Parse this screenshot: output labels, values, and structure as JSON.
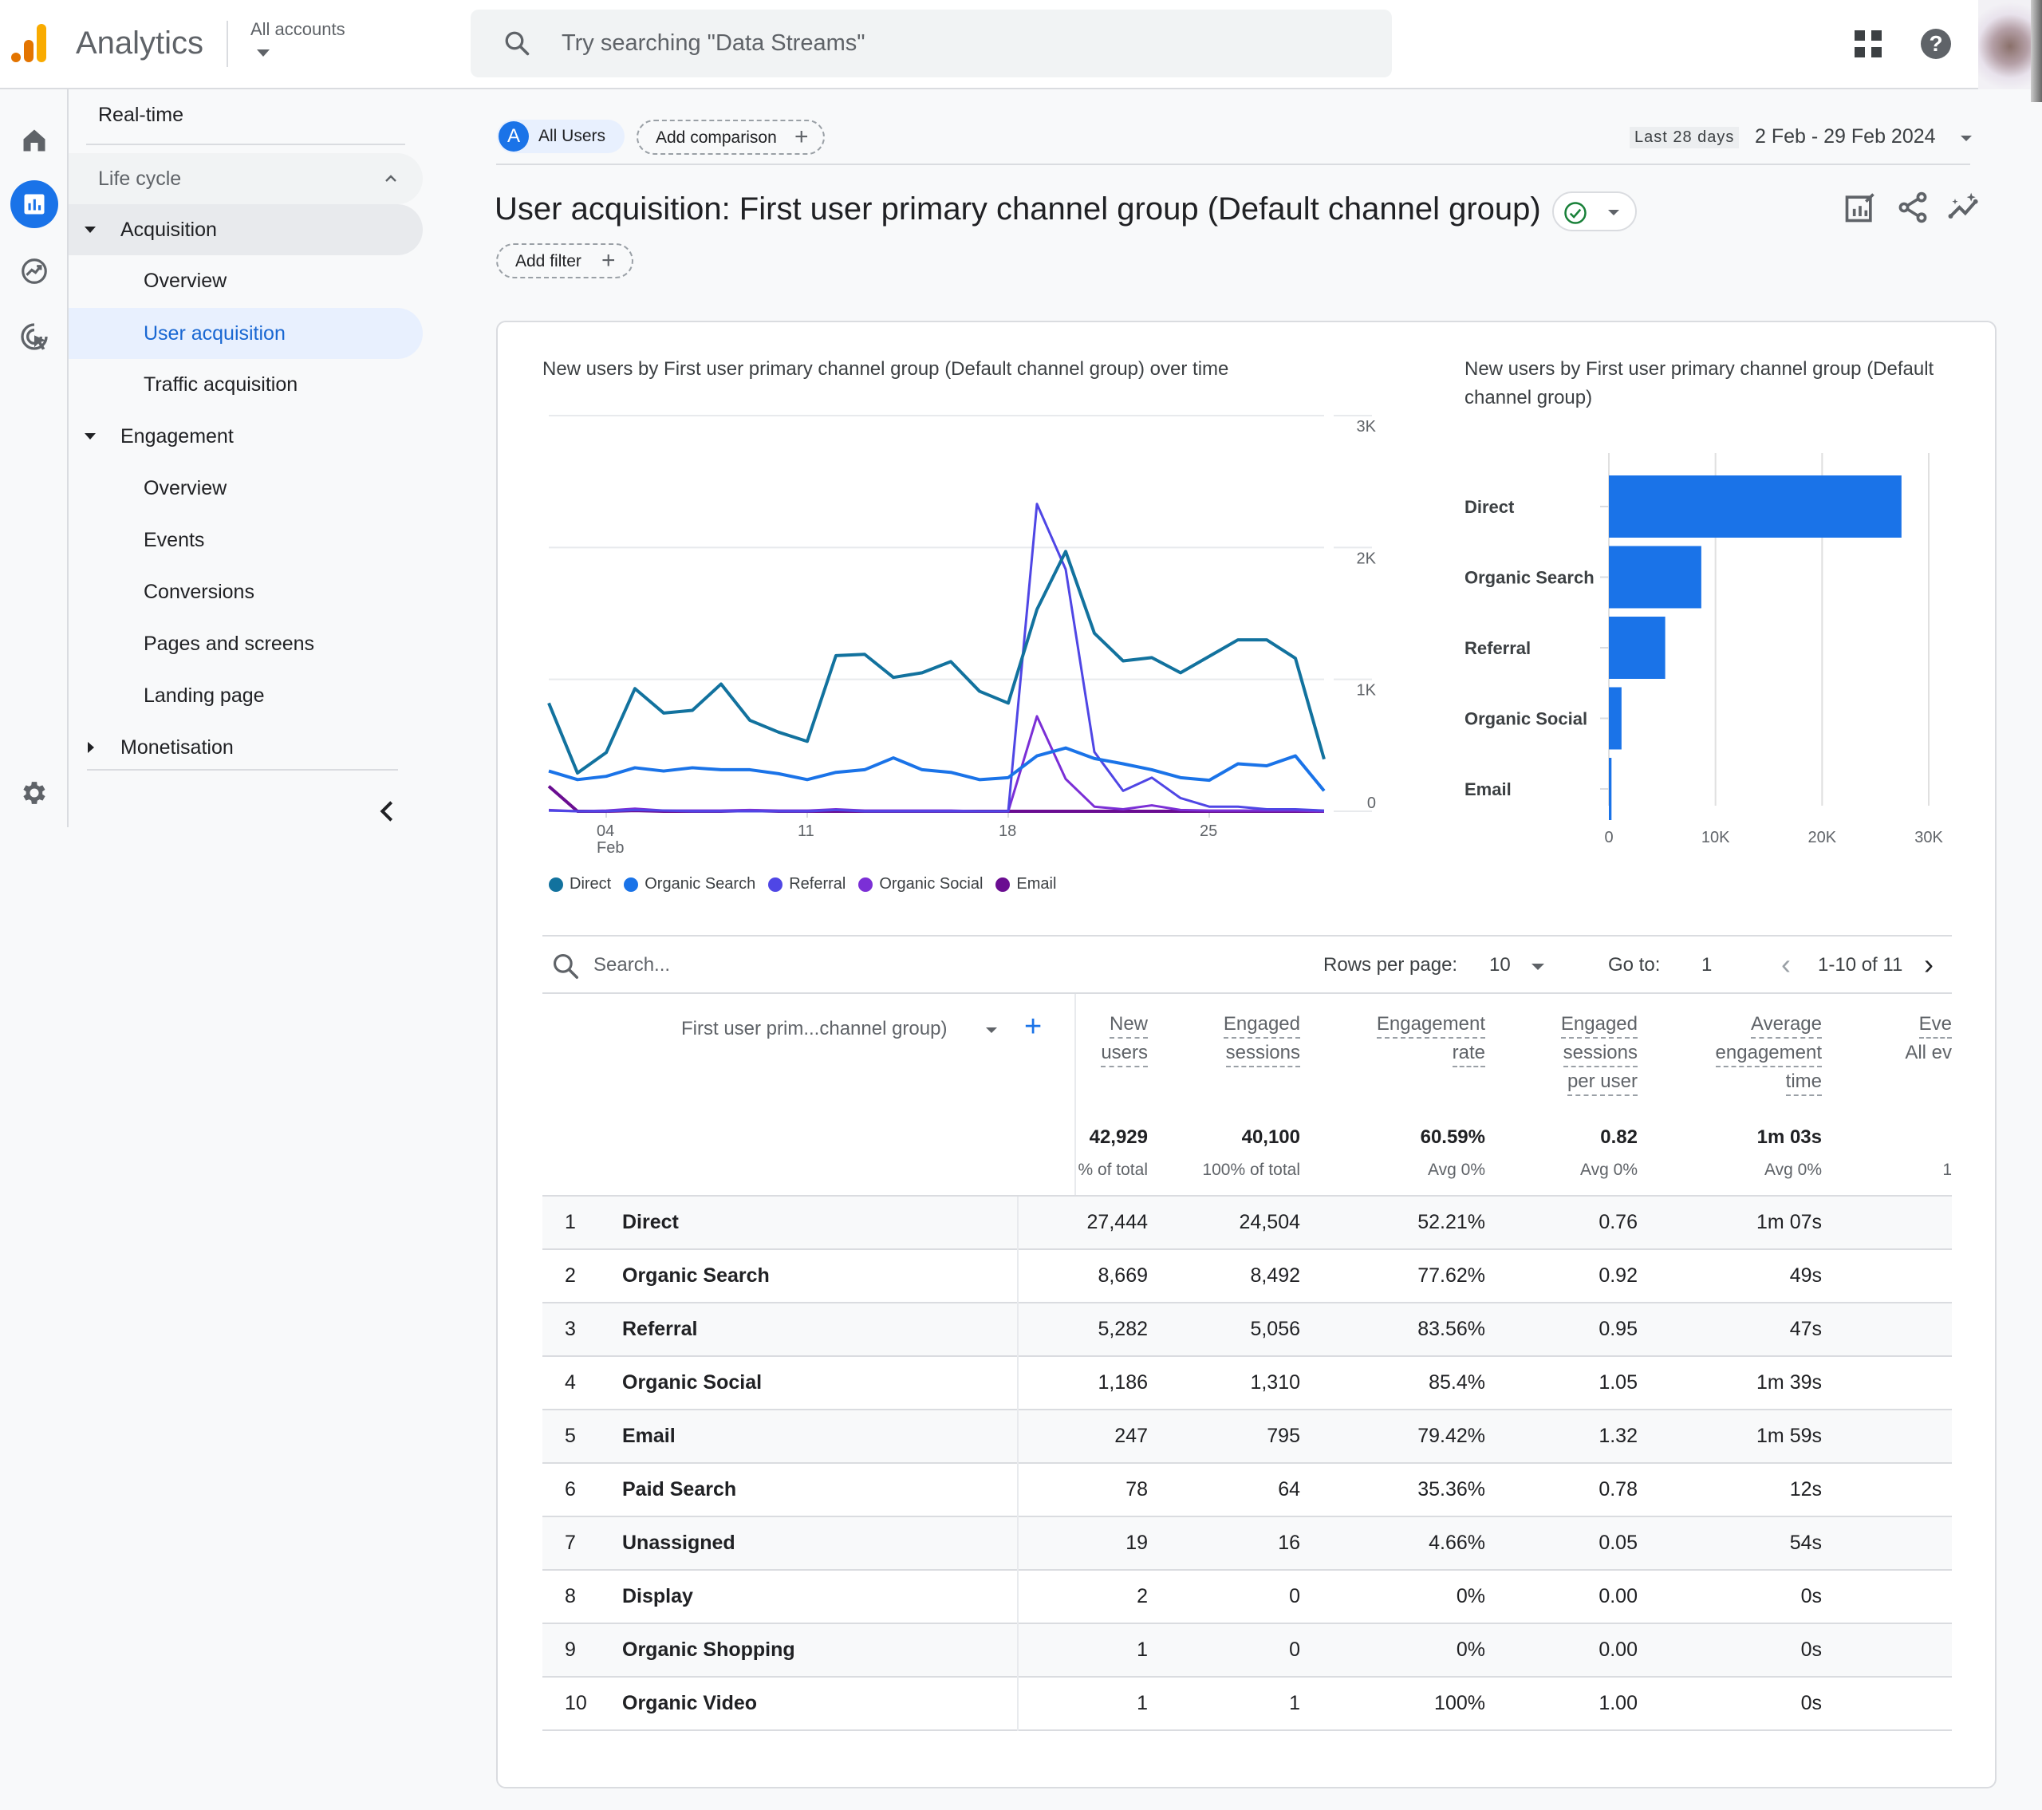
{
  "header": {
    "app_name": "Analytics",
    "account_label": "All accounts",
    "search_placeholder": "Try searching \"Data Streams\"",
    "icons": [
      "apps-grid-icon",
      "help-icon",
      "avatar"
    ]
  },
  "rail": {
    "icons": [
      "home-icon",
      "reports-icon",
      "explore-icon",
      "advertising-icon",
      "settings-icon"
    ],
    "active": "reports-icon"
  },
  "sidebar": {
    "realtime": "Real-time",
    "section": "Life cycle",
    "acquisition": {
      "label": "Acquisition",
      "items": [
        "Overview",
        "User acquisition",
        "Traffic acquisition"
      ],
      "active": "User acquisition"
    },
    "engagement": {
      "label": "Engagement",
      "items": [
        "Overview",
        "Events",
        "Conversions",
        "Pages and screens",
        "Landing page"
      ]
    },
    "monetisation": "Monetisation",
    "collapse_icon": "chevron-left-icon"
  },
  "segments": {
    "chip_letter": "A",
    "chip_label": "All Users",
    "add_comparison": "Add comparison"
  },
  "date": {
    "preset": "Last 28 days",
    "range": "2 Feb - 29 Feb 2024"
  },
  "report": {
    "title": "User acquisition: First user primary channel group (Default channel group)",
    "add_filter": "Add filter",
    "colors": {
      "accent": "#1a73e8",
      "status_ok": "#188038"
    }
  },
  "chart_data": [
    {
      "type": "line",
      "title": "New users by First user primary channel group (Default channel group) over time",
      "x": [
        "Feb 2",
        "Feb 3",
        "Feb 4",
        "Feb 5",
        "Feb 6",
        "Feb 7",
        "Feb 8",
        "Feb 9",
        "Feb 10",
        "Feb 11",
        "Feb 12",
        "Feb 13",
        "Feb 14",
        "Feb 15",
        "Feb 16",
        "Feb 17",
        "Feb 18",
        "Feb 19",
        "Feb 20",
        "Feb 21",
        "Feb 22",
        "Feb 23",
        "Feb 24",
        "Feb 25",
        "Feb 26",
        "Feb 27",
        "Feb 28",
        "Feb 29"
      ],
      "x_tick_labels": [
        {
          "index": 2,
          "label": "04",
          "sub": "Feb"
        },
        {
          "index": 9,
          "label": "11"
        },
        {
          "index": 16,
          "label": "18"
        },
        {
          "index": 23,
          "label": "25"
        }
      ],
      "y_ticks": [
        "0",
        "1K",
        "2K",
        "3K"
      ],
      "ylim": [
        0,
        3000
      ],
      "y_axis_side": "right",
      "grid": true,
      "legend_position": "bottom-left",
      "series": [
        {
          "name": "Direct",
          "color": "#12729e",
          "values": [
            820,
            290,
            445,
            930,
            745,
            765,
            965,
            690,
            600,
            530,
            1180,
            1190,
            1015,
            1050,
            1135,
            910,
            820,
            1530,
            1970,
            1350,
            1140,
            1165,
            1050,
            1175,
            1300,
            1300,
            1160,
            395
          ]
        },
        {
          "name": "Organic Search",
          "color": "#1a73e8",
          "values": [
            305,
            240,
            265,
            330,
            305,
            330,
            315,
            315,
            285,
            240,
            295,
            315,
            405,
            315,
            295,
            240,
            255,
            420,
            480,
            400,
            360,
            315,
            255,
            235,
            360,
            345,
            420,
            155
          ]
        },
        {
          "name": "Referral",
          "color": "#4f46e5",
          "values": [
            5,
            0,
            0,
            10,
            5,
            0,
            0,
            0,
            0,
            0,
            10,
            0,
            0,
            0,
            0,
            0,
            0,
            2330,
            1835,
            450,
            155,
            255,
            100,
            35,
            35,
            15,
            15,
            5
          ]
        },
        {
          "name": "Organic Social",
          "color": "#7b2fd6",
          "values": [
            10,
            0,
            5,
            20,
            5,
            5,
            5,
            10,
            5,
            5,
            15,
            5,
            5,
            5,
            5,
            0,
            0,
            720,
            245,
            35,
            15,
            45,
            10,
            5,
            5,
            5,
            5,
            0
          ]
        },
        {
          "name": "Email",
          "color": "#6a0d91",
          "values": [
            190,
            0,
            0,
            5,
            0,
            0,
            0,
            5,
            0,
            0,
            0,
            0,
            0,
            0,
            0,
            0,
            0,
            0,
            0,
            0,
            0,
            0,
            0,
            0,
            0,
            0,
            0,
            0
          ]
        }
      ]
    },
    {
      "type": "bar",
      "orientation": "horizontal",
      "title": "New users by First user primary channel group (Default channel group)",
      "categories": [
        "Direct",
        "Organic Search",
        "Referral",
        "Organic Social",
        "Email"
      ],
      "values": [
        27444,
        8669,
        5282,
        1186,
        247
      ],
      "x_ticks": [
        "0",
        "10K",
        "20K",
        "30K"
      ],
      "xlim": [
        0,
        30000
      ],
      "color": "#1a73e8",
      "grid": true
    }
  ],
  "table": {
    "search_placeholder": "Search...",
    "rows_per_page_label": "Rows per page:",
    "rows_per_page": "10",
    "goto_label": "Go to:",
    "goto_value": "1",
    "pager": "1-10 of 11",
    "dimension_header": "First user prim...channel group)",
    "columns": [
      {
        "lines": [
          "New",
          "users"
        ],
        "total": "42,929",
        "sub": "% of total"
      },
      {
        "lines": [
          "Engaged",
          "sessions"
        ],
        "total": "40,100",
        "sub": "100% of total"
      },
      {
        "lines": [
          "Engagement",
          "rate"
        ],
        "total": "60.59%",
        "sub": "Avg 0%"
      },
      {
        "lines": [
          "Engaged",
          "sessions",
          "per user"
        ],
        "total": "0.82",
        "sub": "Avg 0%"
      },
      {
        "lines": [
          "Average",
          "engagement",
          "time"
        ],
        "total": "1m 03s",
        "sub": "Avg 0%"
      },
      {
        "lines": [
          "Eve",
          "All ev"
        ],
        "total": "",
        "sub": "1"
      }
    ],
    "rows": [
      {
        "idx": "1",
        "name": "Direct",
        "values": [
          "27,444",
          "24,504",
          "52.21%",
          "0.76",
          "1m 07s"
        ]
      },
      {
        "idx": "2",
        "name": "Organic Search",
        "values": [
          "8,669",
          "8,492",
          "77.62%",
          "0.92",
          "49s"
        ]
      },
      {
        "idx": "3",
        "name": "Referral",
        "values": [
          "5,282",
          "5,056",
          "83.56%",
          "0.95",
          "47s"
        ]
      },
      {
        "idx": "4",
        "name": "Organic Social",
        "values": [
          "1,186",
          "1,310",
          "85.4%",
          "1.05",
          "1m 39s"
        ]
      },
      {
        "idx": "5",
        "name": "Email",
        "values": [
          "247",
          "795",
          "79.42%",
          "1.32",
          "1m 59s"
        ]
      },
      {
        "idx": "6",
        "name": "Paid Search",
        "values": [
          "78",
          "64",
          "35.36%",
          "0.78",
          "12s"
        ]
      },
      {
        "idx": "7",
        "name": "Unassigned",
        "values": [
          "19",
          "16",
          "4.66%",
          "0.05",
          "54s"
        ]
      },
      {
        "idx": "8",
        "name": "Display",
        "values": [
          "2",
          "0",
          "0%",
          "0.00",
          "0s"
        ]
      },
      {
        "idx": "9",
        "name": "Organic Shopping",
        "values": [
          "1",
          "0",
          "0%",
          "0.00",
          "0s"
        ]
      },
      {
        "idx": "10",
        "name": "Organic Video",
        "values": [
          "1",
          "1",
          "100%",
          "1.00",
          "0s"
        ]
      }
    ]
  }
}
